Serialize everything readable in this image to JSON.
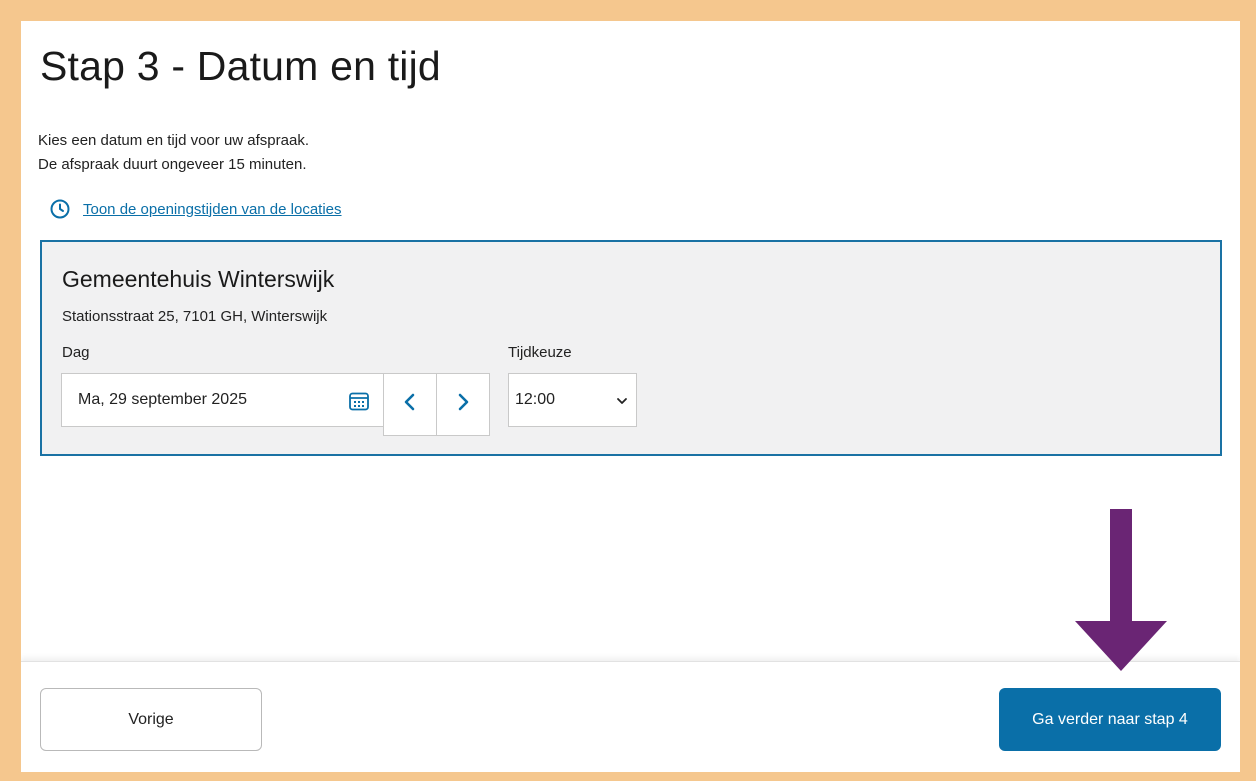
{
  "page": {
    "title": "Stap 3 - Datum en tijd",
    "intro_line_1": "Kies een datum en tijd voor uw afspraak.",
    "intro_line_2": "De afspraak duurt ongeveer 15 minuten.",
    "hours_link": "Toon de openingstijden van de locaties"
  },
  "location": {
    "name": "Gemeentehuis Winterswijk",
    "address": "Stationsstraat 25, 7101 GH, Winterswijk",
    "day_label": "Dag",
    "date_value": "Ma, 29 september 2025",
    "time_label": "Tijdkeuze",
    "time_value": "12:00"
  },
  "footer": {
    "prev_label": "Vorige",
    "next_label": "Ga verder naar stap 4"
  },
  "icons": {
    "clock": "clock-icon",
    "calendar": "calendar-icon",
    "prev": "chevron-left-icon",
    "next": "chevron-right-icon",
    "dropdown": "chevron-down-icon",
    "annotation": "arrow-down-annotation"
  },
  "colors": {
    "accent": "#0a6fa8",
    "frame": "#f5c78e",
    "card_bg": "#f1f1f2",
    "arrow": "#6a2574"
  }
}
